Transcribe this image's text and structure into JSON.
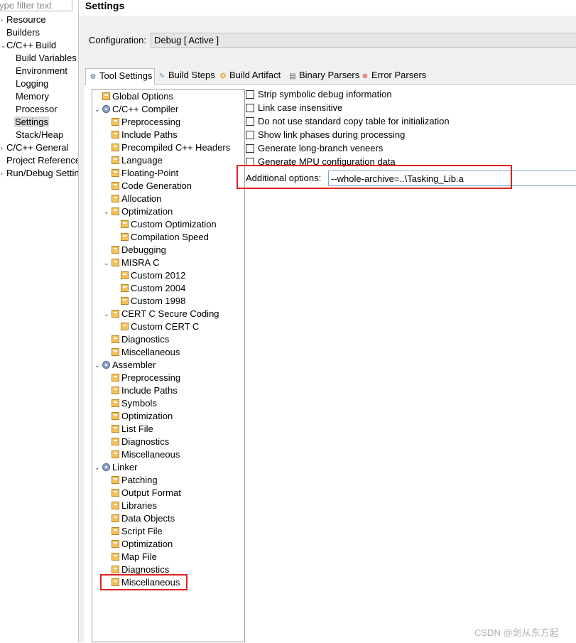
{
  "filter": {
    "placeholder": "ype filter text"
  },
  "nav": {
    "items": [
      {
        "label": "Resource",
        "arrow": "›"
      },
      {
        "label": "Builders",
        "arrow": ""
      },
      {
        "label": "C/C++ Build",
        "arrow": "⌄"
      },
      {
        "label": "Build Variables",
        "arrow": ""
      },
      {
        "label": "Environment",
        "arrow": ""
      },
      {
        "label": "Logging",
        "arrow": ""
      },
      {
        "label": "Memory",
        "arrow": ""
      },
      {
        "label": "Processor",
        "arrow": ""
      },
      {
        "label": "Settings",
        "arrow": ""
      },
      {
        "label": "Stack/Heap",
        "arrow": ""
      },
      {
        "label": "C/C++ General",
        "arrow": "›"
      },
      {
        "label": "Project References",
        "arrow": ""
      },
      {
        "label": "Run/Debug Settings",
        "arrow": "›"
      }
    ]
  },
  "page": {
    "title": "Settings"
  },
  "configuration": {
    "label": "Configuration:",
    "value": "Debug  [ Active ]"
  },
  "tabs": [
    {
      "label": "Tool Settings",
      "icon": "tool-settings-icon",
      "glyph": "⚙"
    },
    {
      "label": "Build Steps",
      "icon": "build-steps-icon",
      "glyph": "✎"
    },
    {
      "label": "Build Artifact",
      "icon": "build-artifact-icon",
      "glyph": "✪"
    },
    {
      "label": "Binary Parsers",
      "icon": "binary-parsers-icon",
      "glyph": "▤"
    },
    {
      "label": "Error Parsers",
      "icon": "error-parsers-icon",
      "glyph": "⊗"
    }
  ],
  "tree": {
    "items": [
      {
        "label": "Global Options"
      },
      {
        "label": "C/C++ Compiler",
        "toggle": "⌄"
      },
      {
        "label": "Preprocessing"
      },
      {
        "label": "Include Paths"
      },
      {
        "label": "Precompiled C++ Headers"
      },
      {
        "label": "Language"
      },
      {
        "label": "Floating-Point"
      },
      {
        "label": "Code Generation"
      },
      {
        "label": "Allocation"
      },
      {
        "label": "Optimization",
        "toggle": "⌄"
      },
      {
        "label": "Custom Optimization"
      },
      {
        "label": "Compilation Speed"
      },
      {
        "label": "Debugging"
      },
      {
        "label": "MISRA C",
        "toggle": "⌄"
      },
      {
        "label": "Custom 2012"
      },
      {
        "label": "Custom 2004"
      },
      {
        "label": "Custom 1998"
      },
      {
        "label": "CERT C Secure Coding",
        "toggle": "⌄"
      },
      {
        "label": "Custom CERT C"
      },
      {
        "label": "Diagnostics"
      },
      {
        "label": "Miscellaneous"
      },
      {
        "label": "Assembler",
        "toggle": "⌄"
      },
      {
        "label": "Preprocessing"
      },
      {
        "label": "Include Paths"
      },
      {
        "label": "Symbols"
      },
      {
        "label": "Optimization"
      },
      {
        "label": "List File"
      },
      {
        "label": "Diagnostics"
      },
      {
        "label": "Miscellaneous"
      },
      {
        "label": "Linker",
        "toggle": "⌄"
      },
      {
        "label": "Patching"
      },
      {
        "label": "Output Format"
      },
      {
        "label": "Libraries"
      },
      {
        "label": "Data Objects"
      },
      {
        "label": "Script File"
      },
      {
        "label": "Optimization"
      },
      {
        "label": "Map File"
      },
      {
        "label": "Diagnostics"
      },
      {
        "label": "Miscellaneous"
      }
    ]
  },
  "options": {
    "checkboxes": [
      {
        "label": "Strip symbolic debug information",
        "checked": false
      },
      {
        "label": "Link case insensitive",
        "checked": false
      },
      {
        "label": "Do not use standard copy table for initialization",
        "checked": false
      },
      {
        "label": "Show link phases during processing",
        "checked": false
      },
      {
        "label": "Generate long-branch veneers",
        "checked": false
      },
      {
        "label": "Generate MPU configuration data",
        "checked": false
      }
    ],
    "additional_label": "Additional options:",
    "additional_value": "--whole-archive=..\\Tasking_Lib.a"
  },
  "highlight_color": "#e02020",
  "watermark": "CSDN @剑从东方起"
}
